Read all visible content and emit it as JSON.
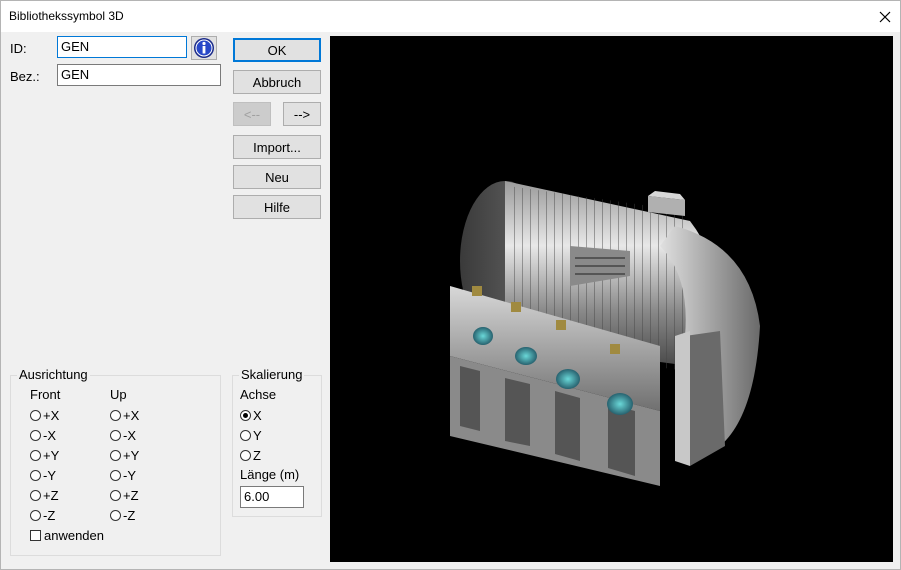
{
  "window": {
    "title": "Bibliothekssymbol 3D"
  },
  "fields": {
    "id_label": "ID:",
    "id_value": "GEN",
    "bez_label": "Bez.:",
    "bez_value": "GEN"
  },
  "buttons": {
    "ok": "OK",
    "cancel": "Abbruch",
    "prev": "<--",
    "next": "-->",
    "import": "Import...",
    "new": "Neu",
    "help": "Hilfe"
  },
  "ausrichtung": {
    "title": "Ausrichtung",
    "front_label": "Front",
    "up_label": "Up",
    "options": [
      "+X",
      "-X",
      "+Y",
      "-Y",
      "+Z",
      "-Z"
    ],
    "apply_label": "anwenden",
    "apply_checked": false
  },
  "skalierung": {
    "title": "Skalierung",
    "axis_label": "Achse",
    "axes": [
      "X",
      "Y",
      "Z"
    ],
    "selected_axis": "X",
    "length_label": "Länge (m)",
    "length_value": "6.00"
  },
  "preview": {
    "object": "generator 3D model",
    "background": "#000000"
  }
}
